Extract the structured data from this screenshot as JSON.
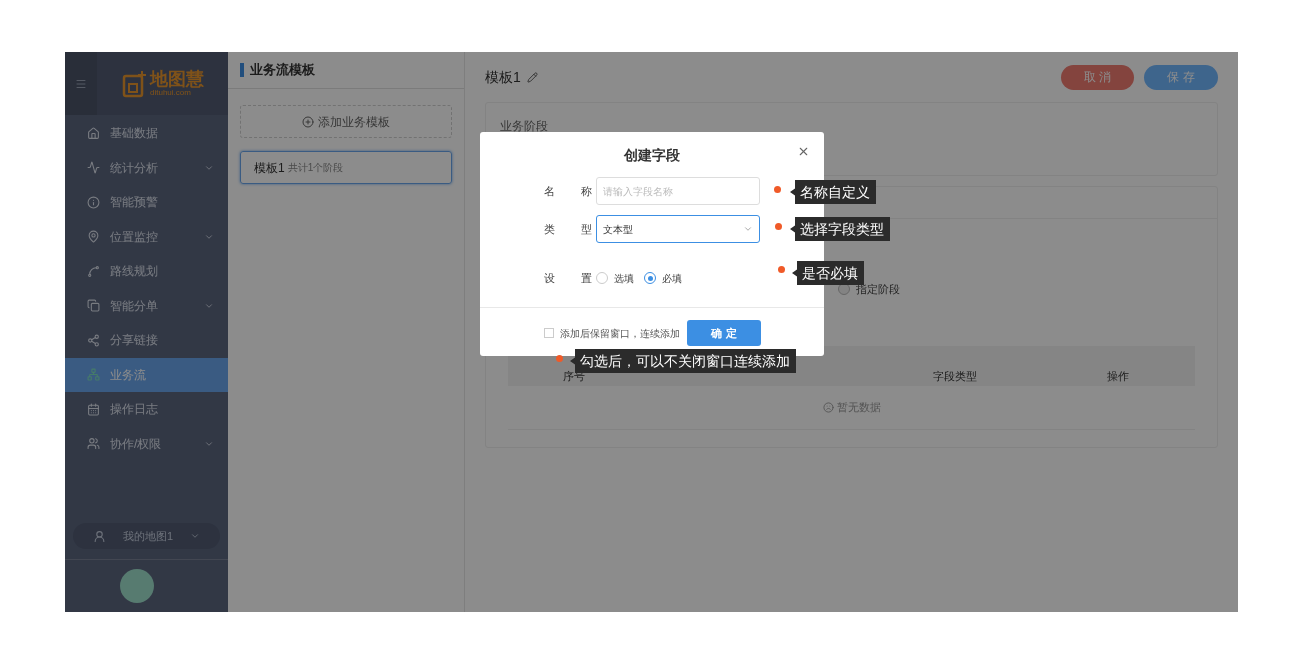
{
  "sidebar": {
    "logo": {
      "name": "地图慧",
      "domain": "dituhui.com"
    },
    "items": [
      {
        "label": "基础数据",
        "expandable": false,
        "selected": false
      },
      {
        "label": "统计分析",
        "expandable": true,
        "selected": false
      },
      {
        "label": "智能预警",
        "expandable": false,
        "selected": false
      },
      {
        "label": "位置监控",
        "expandable": true,
        "selected": false
      },
      {
        "label": "路线规划",
        "expandable": false,
        "selected": false
      },
      {
        "label": "智能分单",
        "expandable": true,
        "selected": false
      },
      {
        "label": "分享链接",
        "expandable": false,
        "selected": false
      },
      {
        "label": "业务流",
        "expandable": false,
        "selected": true
      },
      {
        "label": "操作日志",
        "expandable": false,
        "selected": false
      },
      {
        "label": "协作/权限",
        "expandable": true,
        "selected": false
      }
    ],
    "map_selector": "我的地图1"
  },
  "templates_panel": {
    "title": "业务流模板",
    "add_button": "添加业务模板",
    "templates": [
      {
        "name": "模板1",
        "summary": "共计1个阶段",
        "selected": true
      }
    ]
  },
  "editor": {
    "title": "模板1",
    "cancel": "取 消",
    "save": "保 存",
    "stage_section": "业务阶段",
    "stage_option": {
      "label": "指定阶段",
      "selected": false
    },
    "table": {
      "columns": [
        "序号",
        "字段类型",
        "操作"
      ],
      "empty_text": "暂无数据"
    }
  },
  "dialog": {
    "title": "创建字段",
    "name_label": "名称",
    "name_placeholder": "请输入字段名称",
    "type_label": "类型",
    "type_value": "文本型",
    "setting_label": "设置",
    "options": [
      {
        "label": "选填",
        "selected": false
      },
      {
        "label": "必填",
        "selected": true
      }
    ],
    "keep_open": {
      "label": "添加后保留窗口，连续添加",
      "checked": false
    },
    "confirm": "确 定"
  },
  "annotations": [
    {
      "text": "名称自定义"
    },
    {
      "text": "选择字段类型"
    },
    {
      "text": "是否必填"
    },
    {
      "text": "勾选后，可以不关闭窗口连续添加"
    }
  ]
}
